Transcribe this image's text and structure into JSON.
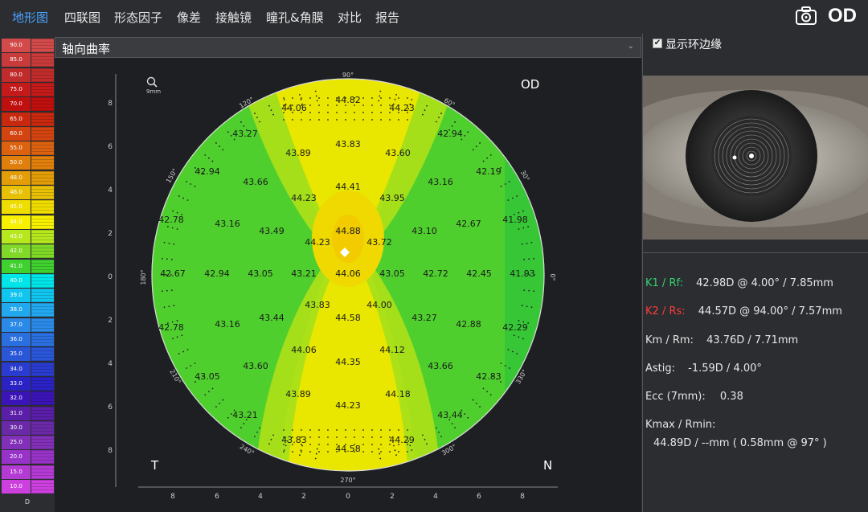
{
  "tabs": [
    "地形图",
    "四联图",
    "形态因子",
    "像差",
    "接触镜",
    "瞳孔&角膜",
    "对比",
    "报告"
  ],
  "eye": "OD",
  "map": {
    "title": "轴向曲率",
    "axis_labels": {
      "top": "90°",
      "left": "180°",
      "right": "0°",
      "bottom": "270°",
      "d120": "120°",
      "d60": "60°",
      "d150": "150°",
      "d30": "30°",
      "d210": "210°",
      "d330": "330°",
      "d240": "240°",
      "d300": "300°"
    },
    "zoom_label": "9mm",
    "corner_tl": "OD",
    "corner_t": "T",
    "corner_n": "N",
    "y_ticks": [
      "8",
      "6",
      "4",
      "2",
      "0",
      "2",
      "4",
      "6",
      "8"
    ],
    "x_ticks": [
      "8",
      "6",
      "4",
      "2",
      "0",
      "2",
      "4",
      "6",
      "8"
    ],
    "values": [
      {
        "t": "44.06"
      },
      {
        "t": "44.82"
      },
      {
        "t": "44.23"
      },
      {
        "t": "43.27"
      },
      {
        "t": "43.83"
      },
      {
        "t": "42.94"
      },
      {
        "t": "43.89"
      },
      {
        "t": "43.60"
      },
      {
        "t": "42.94"
      },
      {
        "t": "42.19"
      },
      {
        "t": "43.66"
      },
      {
        "t": "44.41"
      },
      {
        "t": "43.16"
      },
      {
        "t": "44.23"
      },
      {
        "t": "43.95"
      },
      {
        "t": "42.78"
      },
      {
        "t": "43.16"
      },
      {
        "t": "42.67"
      },
      {
        "t": "41.98"
      },
      {
        "t": "43.49"
      },
      {
        "t": "44.88"
      },
      {
        "t": "43.10"
      },
      {
        "t": "44.23"
      },
      {
        "t": "43.72"
      },
      {
        "t": "42.67"
      },
      {
        "t": "42.94"
      },
      {
        "t": "43.05"
      },
      {
        "t": "43.21"
      },
      {
        "t": "44.06"
      },
      {
        "t": "43.05"
      },
      {
        "t": "42.72"
      },
      {
        "t": "42.45"
      },
      {
        "t": "41.93"
      },
      {
        "t": "43.83"
      },
      {
        "t": "44.00"
      },
      {
        "t": "43.44"
      },
      {
        "t": "44.58"
      },
      {
        "t": "43.27"
      },
      {
        "t": "42.78"
      },
      {
        "t": "43.16"
      },
      {
        "t": "42.88"
      },
      {
        "t": "42.29"
      },
      {
        "t": "44.06"
      },
      {
        "t": "44.12"
      },
      {
        "t": "43.60"
      },
      {
        "t": "44.35"
      },
      {
        "t": "43.66"
      },
      {
        "t": "43.05"
      },
      {
        "t": "42.83"
      },
      {
        "t": "43.89"
      },
      {
        "t": "44.18"
      },
      {
        "t": "44.23"
      },
      {
        "t": "43.21"
      },
      {
        "t": "43.44"
      },
      {
        "t": "43.83"
      },
      {
        "t": "44.29"
      },
      {
        "t": "44.58"
      }
    ]
  },
  "scale": {
    "labels": [
      "90.0",
      "85.0",
      "80.0",
      "75.0",
      "70.0",
      "65.0",
      "60.0",
      "55.0",
      "50.0",
      "48.0",
      "46.0",
      "45.0",
      "44.0",
      "43.0",
      "42.0",
      "41.0",
      "40.0",
      "39.0",
      "38.0",
      "37.0",
      "36.0",
      "35.0",
      "34.0",
      "33.0",
      "32.0",
      "31.0",
      "30.0",
      "25.0",
      "20.0",
      "15.0",
      "10.0"
    ],
    "colors": [
      "#d24a4a",
      "#c93b3b",
      "#c02c2c",
      "#c41a1a",
      "#bf0f0f",
      "#c8280e",
      "#d34410",
      "#dc6210",
      "#e07f0c",
      "#e39d08",
      "#e8c006",
      "#f0dd00",
      "#f7f000",
      "#b7e81e",
      "#7fd926",
      "#40d030",
      "#00e5e8",
      "#12c5ef",
      "#22a8ef",
      "#2b8ae8",
      "#2a6fe0",
      "#2a56d8",
      "#2a3cd0",
      "#2a22c4",
      "#3b14b8",
      "#5a1ea8",
      "#6a2aa8",
      "#8230b8",
      "#9833c8",
      "#b43ad4",
      "#cc40de"
    ],
    "unit": "D"
  },
  "right": {
    "checkbox_label": "显示环边缘",
    "checkbox_checked": "✔",
    "k1_label": "K1 / Rf:",
    "k1_value": "42.98D @ 4.00° / 7.85mm",
    "k2_label": "K2 / Rs:",
    "k2_value": "44.57D @ 94.00° / 7.57mm",
    "km_label": "Km / Rm:",
    "km_value": "43.76D / 7.71mm",
    "astig_label": "Astig:",
    "astig_value": "-1.59D / 4.00°",
    "ecc_label": "Ecc (7mm):",
    "ecc_value": "0.38",
    "kmax_label": "Kmax / Rmin:",
    "kmax_value": "44.89D / --mm ( 0.58mm @ 97° )"
  },
  "colors": {
    "active_tab": "#4aa3ff",
    "k1": "#35d26f",
    "k2": "#ff3b3b",
    "background": "#2b2d31"
  }
}
